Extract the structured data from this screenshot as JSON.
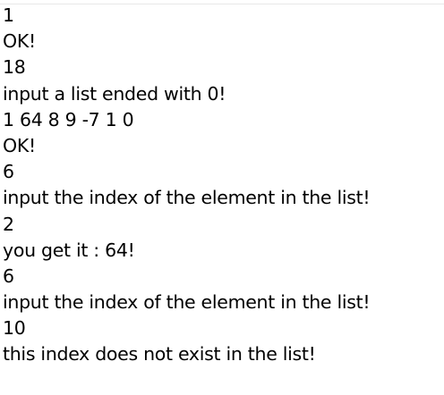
{
  "console": {
    "lines": [
      "1",
      "OK!",
      "18",
      "input a list ended with 0!",
      "1 64 8 9 -7 1 0",
      "OK!",
      "6",
      "input the index of the element in the list!",
      "2",
      "you get it : 64!",
      "6",
      "input the index of the element in the list!",
      "10",
      "this index does not exist in the list!"
    ]
  }
}
